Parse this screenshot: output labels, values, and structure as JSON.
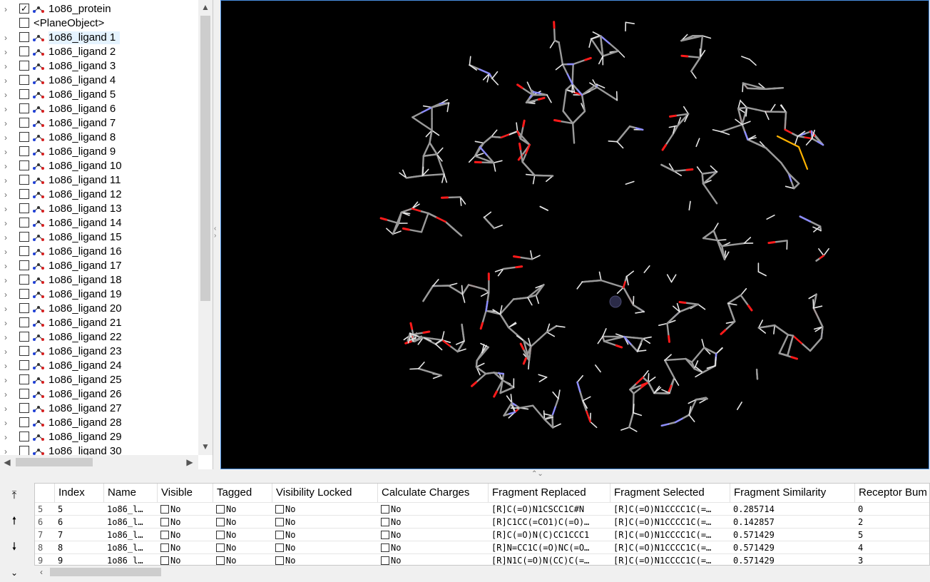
{
  "tree": {
    "items": [
      {
        "label": "1o86_protein",
        "checked": true,
        "kind": "protein"
      },
      {
        "label": "<PlaneObject>",
        "checked": false,
        "kind": "plane"
      },
      {
        "label": "1o86_ligand 1",
        "checked": false,
        "kind": "ligand",
        "selected": true
      },
      {
        "label": "1o86_ligand 2",
        "checked": false,
        "kind": "ligand"
      },
      {
        "label": "1o86_ligand 3",
        "checked": false,
        "kind": "ligand"
      },
      {
        "label": "1o86_ligand 4",
        "checked": false,
        "kind": "ligand"
      },
      {
        "label": "1o86_ligand 5",
        "checked": false,
        "kind": "ligand"
      },
      {
        "label": "1o86_ligand 6",
        "checked": false,
        "kind": "ligand"
      },
      {
        "label": "1o86_ligand 7",
        "checked": false,
        "kind": "ligand"
      },
      {
        "label": "1o86_ligand 8",
        "checked": false,
        "kind": "ligand"
      },
      {
        "label": "1o86_ligand 9",
        "checked": false,
        "kind": "ligand"
      },
      {
        "label": "1o86_ligand 10",
        "checked": false,
        "kind": "ligand"
      },
      {
        "label": "1o86_ligand 11",
        "checked": false,
        "kind": "ligand"
      },
      {
        "label": "1o86_ligand 12",
        "checked": false,
        "kind": "ligand"
      },
      {
        "label": "1o86_ligand 13",
        "checked": false,
        "kind": "ligand"
      },
      {
        "label": "1o86_ligand 14",
        "checked": false,
        "kind": "ligand"
      },
      {
        "label": "1o86_ligand 15",
        "checked": false,
        "kind": "ligand"
      },
      {
        "label": "1o86_ligand 16",
        "checked": false,
        "kind": "ligand"
      },
      {
        "label": "1o86_ligand 17",
        "checked": false,
        "kind": "ligand"
      },
      {
        "label": "1o86_ligand 18",
        "checked": false,
        "kind": "ligand"
      },
      {
        "label": "1o86_ligand 19",
        "checked": false,
        "kind": "ligand"
      },
      {
        "label": "1o86_ligand 20",
        "checked": false,
        "kind": "ligand"
      },
      {
        "label": "1o86_ligand 21",
        "checked": false,
        "kind": "ligand"
      },
      {
        "label": "1o86_ligand 22",
        "checked": false,
        "kind": "ligand"
      },
      {
        "label": "1o86_ligand 23",
        "checked": false,
        "kind": "ligand"
      },
      {
        "label": "1o86_ligand 24",
        "checked": false,
        "kind": "ligand"
      },
      {
        "label": "1o86_ligand 25",
        "checked": false,
        "kind": "ligand"
      },
      {
        "label": "1o86_ligand 26",
        "checked": false,
        "kind": "ligand"
      },
      {
        "label": "1o86_ligand 27",
        "checked": false,
        "kind": "ligand"
      },
      {
        "label": "1o86_ligand 28",
        "checked": false,
        "kind": "ligand"
      },
      {
        "label": "1o86_ligand 29",
        "checked": false,
        "kind": "ligand"
      },
      {
        "label": "1o86_ligand 30",
        "checked": false,
        "kind": "ligand"
      }
    ]
  },
  "viewer": {
    "background": "#000000",
    "colors": {
      "carbon": "#9a9a9a",
      "hydrogen": "#e6e6e6",
      "nitrogen": "#8c8cff",
      "oxygen": "#ff1a1a",
      "sulfur": "#ffb300"
    }
  },
  "table": {
    "columns": [
      "Index",
      "Name",
      "Visible",
      "Tagged",
      "Visibility Locked",
      "Calculate Charges",
      "Fragment Replaced",
      "Fragment Selected",
      "Fragment Similarity",
      "Receptor Bum"
    ],
    "rows": [
      {
        "rownum": "5",
        "index": "5",
        "name": "1o86_l…",
        "visible": "No",
        "tagged": "No",
        "locked": "No",
        "charges": "No",
        "replaced": "[R]C(=O)N1CSCC1C#N",
        "selected": "[R]C(=O)N1CCCC1C(=…",
        "similarity": "0.285714",
        "bump": "0"
      },
      {
        "rownum": "6",
        "index": "6",
        "name": "1o86_l…",
        "visible": "No",
        "tagged": "No",
        "locked": "No",
        "charges": "No",
        "replaced": "[R]C1CC(=CO1)C(=O)…",
        "selected": "[R]C(=O)N1CCCC1C(=…",
        "similarity": "0.142857",
        "bump": "2"
      },
      {
        "rownum": "7",
        "index": "7",
        "name": "1o86_l…",
        "visible": "No",
        "tagged": "No",
        "locked": "No",
        "charges": "No",
        "replaced": "[R]C(=O)N(C)CC1CCC1",
        "selected": "[R]C(=O)N1CCCC1C(=…",
        "similarity": "0.571429",
        "bump": "5"
      },
      {
        "rownum": "8",
        "index": "8",
        "name": "1o86_l…",
        "visible": "No",
        "tagged": "No",
        "locked": "No",
        "charges": "No",
        "replaced": "[R]N=CC1C(=O)NC(=O…",
        "selected": "[R]C(=O)N1CCCC1C(=…",
        "similarity": "0.571429",
        "bump": "4"
      },
      {
        "rownum": "9",
        "index": "9",
        "name": "1o86_l…",
        "visible": "No",
        "tagged": "No",
        "locked": "No",
        "charges": "No",
        "replaced": "[R]N1C(=O)N(CC)C(=…",
        "selected": "[R]C(=O)N1CCCC1C(=…",
        "similarity": "0.571429",
        "bump": "3"
      }
    ]
  },
  "nav": {
    "first_icon": "arrow-to-top-icon",
    "up_icon": "arrow-up-icon",
    "down_icon": "arrow-down-icon",
    "last_icon": "double-chevron-down-icon"
  }
}
